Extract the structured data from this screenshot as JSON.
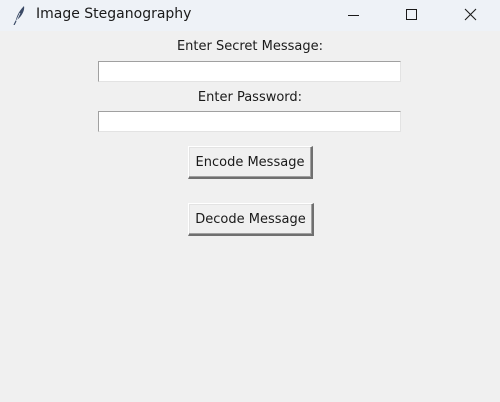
{
  "window": {
    "title": "Image Steganography",
    "app_icon": "feather-icon",
    "controls": {
      "minimize_icon": "minimize-icon",
      "maximize_icon": "maximize-icon",
      "close_icon": "close-icon"
    }
  },
  "form": {
    "secret_label": "Enter Secret Message:",
    "secret_value": "",
    "password_label": "Enter Password:",
    "password_value": "",
    "encode_button": "Encode Message",
    "decode_button": "Decode Message"
  }
}
